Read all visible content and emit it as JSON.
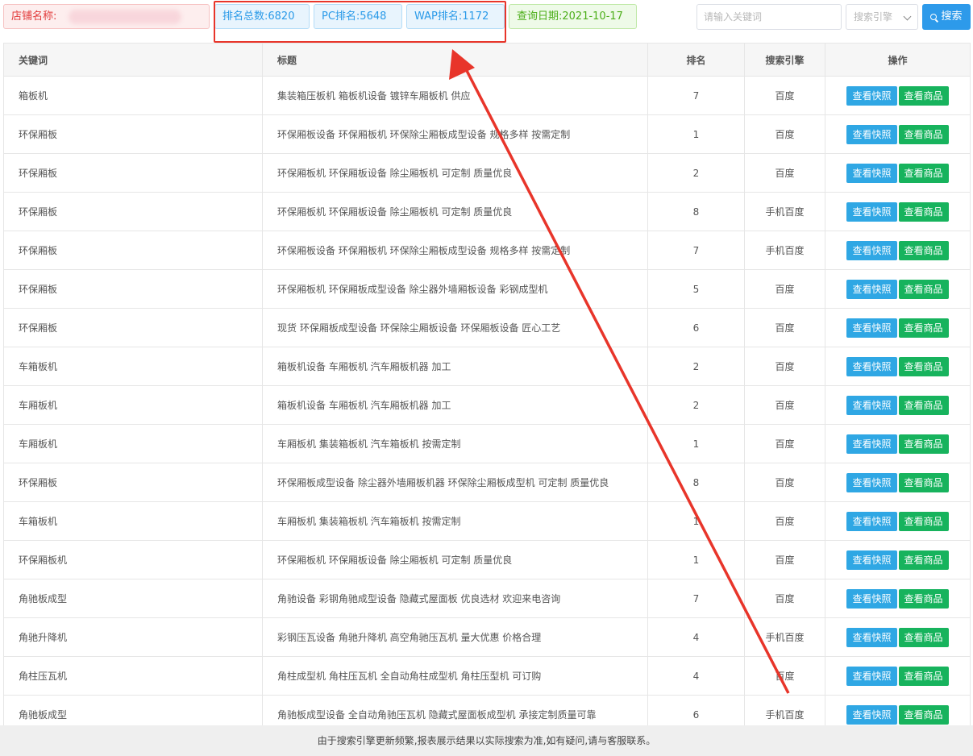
{
  "topbar": {
    "shop_label": "店铺名称:",
    "total_rank": "排名总数:6820",
    "pc_rank": "PC排名:5648",
    "wap_rank": "WAP排名:1172",
    "query_date": "查询日期:2021-10-17"
  },
  "search": {
    "placeholder": "请输入关键词",
    "engine_placeholder": "搜索引擎",
    "button_label": "搜索"
  },
  "table": {
    "headers": [
      "关键词",
      "标题",
      "排名",
      "搜索引擎",
      "操作"
    ],
    "rows": [
      {
        "keyword": "箱板机",
        "title": "集装箱压板机 箱板机设备 镀锌车厢板机 供应",
        "rank": "7",
        "engine": "百度"
      },
      {
        "keyword": "环保厢板",
        "title": "环保厢板设备 环保厢板机 环保除尘厢板成型设备 规格多样 按需定制",
        "rank": "1",
        "engine": "百度"
      },
      {
        "keyword": "环保厢板",
        "title": "环保厢板机 环保厢板设备 除尘厢板机 可定制 质量优良",
        "rank": "2",
        "engine": "百度"
      },
      {
        "keyword": "环保厢板",
        "title": "环保厢板机 环保厢板设备 除尘厢板机 可定制 质量优良",
        "rank": "8",
        "engine": "手机百度"
      },
      {
        "keyword": "环保厢板",
        "title": "环保厢板设备 环保厢板机 环保除尘厢板成型设备 规格多样 按需定制",
        "rank": "7",
        "engine": "手机百度"
      },
      {
        "keyword": "环保厢板",
        "title": "环保厢板机 环保厢板成型设备 除尘器外墙厢板设备 彩钢成型机",
        "rank": "5",
        "engine": "百度"
      },
      {
        "keyword": "环保厢板",
        "title": "现货 环保厢板成型设备 环保除尘厢板设备 环保厢板设备 匠心工艺",
        "rank": "6",
        "engine": "百度"
      },
      {
        "keyword": "车箱板机",
        "title": "箱板机设备 车厢板机 汽车厢板机器 加工",
        "rank": "2",
        "engine": "百度"
      },
      {
        "keyword": "车厢板机",
        "title": "箱板机设备 车厢板机 汽车厢板机器 加工",
        "rank": "2",
        "engine": "百度"
      },
      {
        "keyword": "车厢板机",
        "title": "车厢板机 集装箱板机 汽车箱板机 按需定制",
        "rank": "1",
        "engine": "百度"
      },
      {
        "keyword": "环保厢板",
        "title": "环保厢板成型设备 除尘器外墙厢板机器 环保除尘厢板成型机 可定制 质量优良",
        "rank": "8",
        "engine": "百度"
      },
      {
        "keyword": "车箱板机",
        "title": "车厢板机 集装箱板机 汽车箱板机 按需定制",
        "rank": "1",
        "engine": "百度"
      },
      {
        "keyword": "环保厢板机",
        "title": "环保厢板机 环保厢板设备 除尘厢板机 可定制 质量优良",
        "rank": "1",
        "engine": "百度"
      },
      {
        "keyword": "角驰板成型",
        "title": "角驰设备 彩钢角驰成型设备 隐藏式屋面板 优良选材 欢迎来电咨询",
        "rank": "7",
        "engine": "百度"
      },
      {
        "keyword": "角驰升降机",
        "title": "彩钢压瓦设备 角驰升降机 高空角驰压瓦机 量大优惠 价格合理",
        "rank": "4",
        "engine": "手机百度"
      },
      {
        "keyword": "角柱压瓦机",
        "title": "角柱成型机 角柱压瓦机 全自动角柱成型机 角柱压型机 可订购",
        "rank": "4",
        "engine": "百度"
      },
      {
        "keyword": "角驰板成型",
        "title": "角驰板成型设备 全自动角驰压瓦机 隐藏式屋面板成型机 承接定制质量可靠",
        "rank": "6",
        "engine": "手机百度"
      }
    ],
    "snapshot_label": "查看快照",
    "goods_label": "查看商品"
  },
  "footer": {
    "notice": "由于搜索引擎更新频繁,报表展示结果以实际搜索为准,如有疑问,请与客服联系。"
  },
  "annotation": {
    "color": "#e8352a"
  }
}
